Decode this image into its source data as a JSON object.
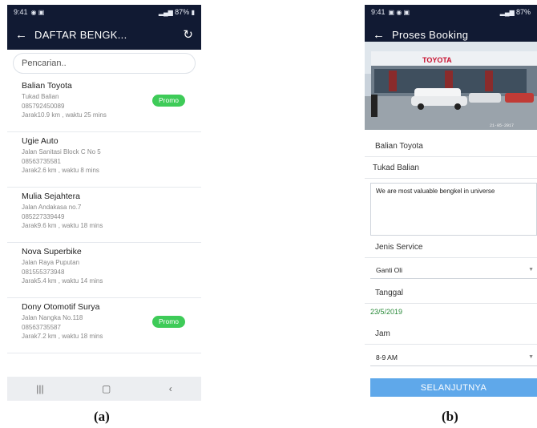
{
  "phone_a": {
    "status": {
      "time": "9:41",
      "right": "87%"
    },
    "app_title": "DAFTAR BENGK...",
    "search_placeholder": "Pencarian..",
    "items": [
      {
        "name": "Balian Toyota",
        "address": "Tukad Balian",
        "phone": "085792450089",
        "distance": "Jarak10.9 km ,  waktu  25 mins",
        "promo": "Promo"
      },
      {
        "name": "Ugie Auto",
        "address": "Jalan Sanitasi Block C No 5",
        "phone": "08563735581",
        "distance": "Jarak2.6 km ,  waktu  8 mins",
        "promo": ""
      },
      {
        "name": "Mulia Sejahtera",
        "address": "Jalan Andakasa no.7",
        "phone": "085227339449",
        "distance": "Jarak9.6 km ,  waktu  18 mins",
        "promo": ""
      },
      {
        "name": "Nova Superbike",
        "address": "Jalan Raya Puputan",
        "phone": "081555373948",
        "distance": "Jarak5.4 km ,  waktu  14 mins",
        "promo": ""
      },
      {
        "name": "Dony Otomotif Surya",
        "address": "Jalan Nangka No.118",
        "phone": "08563735587",
        "distance": "Jarak7.2 km ,  waktu  18 mins",
        "promo": "Promo"
      }
    ]
  },
  "phone_b": {
    "status": {
      "time": "9:41",
      "right": "87%"
    },
    "app_title": "Proses Booking",
    "photo_brand": "TOYOTA",
    "photo_timestamp": "21-05-2017",
    "workshop_name": "Balian Toyota",
    "workshop_address": "Tukad Balian",
    "description": "We are most valuable bengkel in universe",
    "service_label": "Jenis Service",
    "service_value": "Ganti Oli",
    "date_label": "Tanggal",
    "date_value": "23/5/2019",
    "time_label": "Jam",
    "time_value": "8-9 AM",
    "next_button": "SELANJUTNYA"
  },
  "captions": {
    "a": "(a)",
    "b": "(b)"
  },
  "colors": {
    "appbar": "#111a33",
    "promo": "#3ecb58",
    "button": "#5fa8ea",
    "date": "#2a8a3a"
  },
  "icons": [
    "back-arrow-icon",
    "refresh-icon",
    "recent-apps-icon",
    "home-icon",
    "nav-back-icon",
    "dropdown-caret-icon"
  ]
}
